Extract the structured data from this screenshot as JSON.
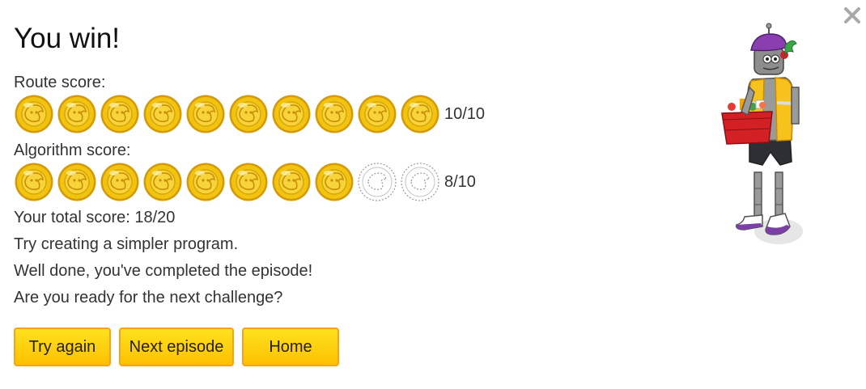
{
  "dialog": {
    "title": "You win!",
    "close_icon": "close-icon"
  },
  "route_score": {
    "label": "Route score:",
    "earned": 10,
    "max": 10,
    "text": "10/10"
  },
  "algorithm_score": {
    "label": "Algorithm score:",
    "earned": 8,
    "max": 10,
    "text": "8/10"
  },
  "messages": {
    "total": "Your total score: 18/20",
    "hint": "Try creating a simpler program.",
    "completed": "Well done, you've completed the episode!",
    "next": "Are you ready for the next challenge?"
  },
  "buttons": {
    "try_again": "Try again",
    "next_episode": "Next episode",
    "home": "Home"
  },
  "colors": {
    "coin_fill": "#f2c40f",
    "coin_edge": "#d49a0a",
    "button_fill": "#fdd10f",
    "button_border": "#f7a21b"
  },
  "icons": {
    "coin": "coin-icon",
    "empty_coin": "empty-coin-icon",
    "robot": "robot-delivery-character"
  }
}
